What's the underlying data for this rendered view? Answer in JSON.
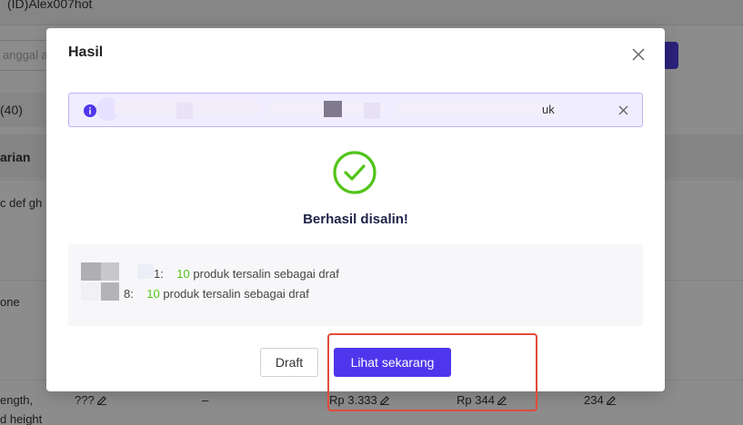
{
  "background": {
    "account_label": "(ID)Alex007hot",
    "date_placeholder": "anggal a",
    "tab_count": "(40)",
    "variant_header": "arian",
    "row1_text": "c def gh",
    "row2_text": "one",
    "row3_text_line1": "ength,",
    "row3_text_line2": "d height",
    "row3_sku": "???",
    "row3_dash": "–",
    "row3_price1": "Rp 3.333",
    "row3_price2": "Rp 344",
    "row3_stock": "234"
  },
  "modal": {
    "title": "Hasil",
    "alert_tail": "uk",
    "success_message": "Berhasil disalin!",
    "results": [
      {
        "label_suffix": "1:",
        "count": "10",
        "text": "produk tersalin sebagai draf"
      },
      {
        "label_suffix": "8:",
        "count": "10",
        "text": "produk tersalin sebagai draf"
      }
    ],
    "draft_button": "Draft",
    "view_button": "Lihat sekarang"
  },
  "colors": {
    "primary": "#4f36ec",
    "success": "#52c41a",
    "highlight": "#e34a3c"
  },
  "icons": {
    "close": "close-icon",
    "info": "info-icon",
    "success": "check-circle-icon",
    "edit": "pencil-icon"
  }
}
